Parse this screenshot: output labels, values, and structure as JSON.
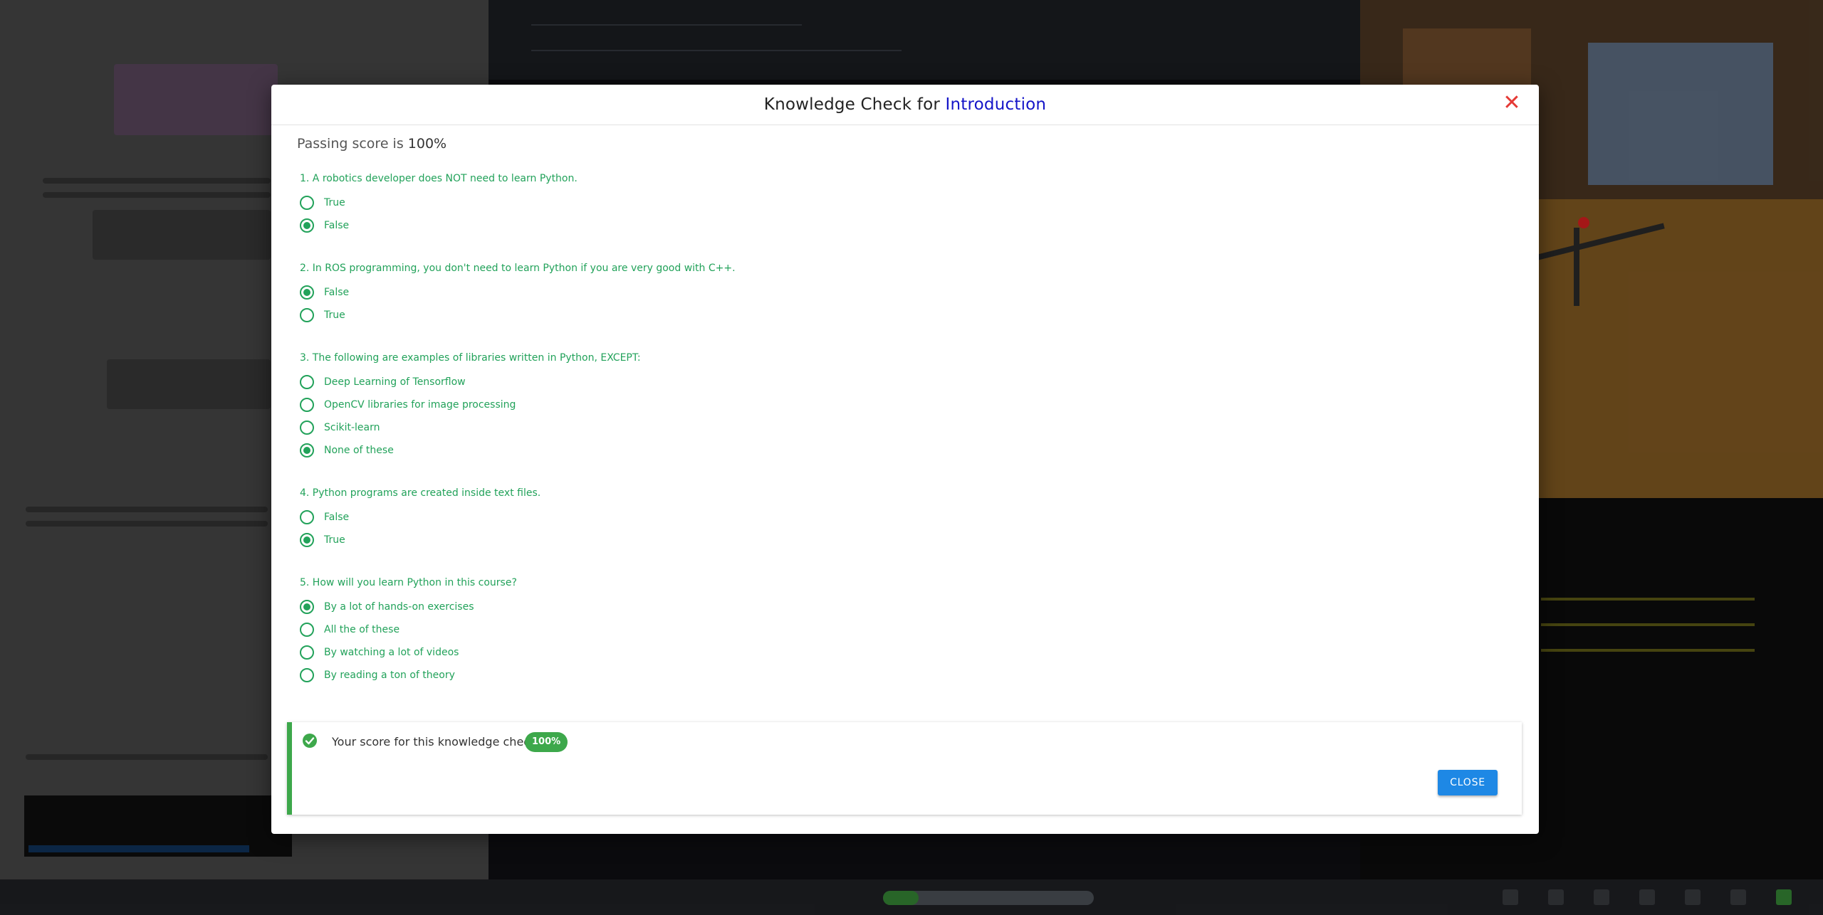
{
  "modal": {
    "title_prefix": "Knowledge Check for ",
    "title_topic": "Introduction",
    "close_icon": "✕",
    "passing_label": "Passing score is ",
    "passing_value": "100%"
  },
  "questions": [
    {
      "text": "1. A robotics developer does NOT need to learn Python.",
      "options": [
        {
          "label": "True",
          "selected": false
        },
        {
          "label": "False",
          "selected": true
        }
      ]
    },
    {
      "text": "2. In ROS programming, you don't need to learn Python if you are very good with C++.",
      "options": [
        {
          "label": "False",
          "selected": true
        },
        {
          "label": "True",
          "selected": false
        }
      ]
    },
    {
      "text": "3. The following are examples of libraries written in Python, EXCEPT:",
      "options": [
        {
          "label": "Deep Learning of Tensorflow",
          "selected": false
        },
        {
          "label": "OpenCV libraries for image processing",
          "selected": false
        },
        {
          "label": "Scikit-learn",
          "selected": false
        },
        {
          "label": "None of these",
          "selected": true
        }
      ]
    },
    {
      "text": "4. Python programs are created inside text files.",
      "options": [
        {
          "label": "False",
          "selected": false
        },
        {
          "label": "True",
          "selected": true
        }
      ]
    },
    {
      "text": "5. How will you learn Python in this course?",
      "options": [
        {
          "label": "By a lot of hands-on exercises",
          "selected": true
        },
        {
          "label": "All the of these",
          "selected": false
        },
        {
          "label": "By watching a lot of videos",
          "selected": false
        },
        {
          "label": "By reading a ton of theory",
          "selected": false
        }
      ]
    }
  ],
  "score": {
    "label": "Your score for this knowledge check:",
    "value": "100%",
    "close_button": "CLOSE"
  },
  "colors": {
    "accent_green": "#22a25a",
    "badge_green": "#3da84b",
    "close_blue": "#1e88e5",
    "title_topic": "#1414c8",
    "close_x_red": "#e53935"
  }
}
